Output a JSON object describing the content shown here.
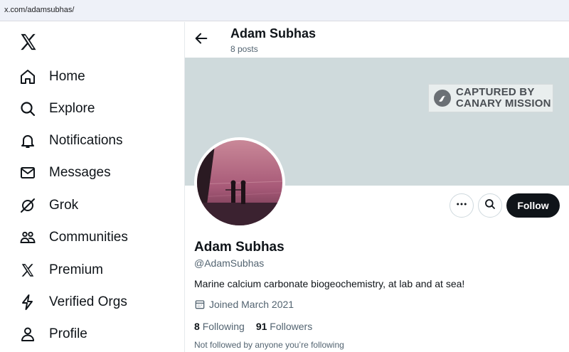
{
  "browser": {
    "url": "x.com/adamsubhas/"
  },
  "sidebar": {
    "logo_icon": "x-logo-icon",
    "items": [
      {
        "label": "Home",
        "icon": "home-icon"
      },
      {
        "label": "Explore",
        "icon": "search-icon"
      },
      {
        "label": "Notifications",
        "icon": "bell-icon"
      },
      {
        "label": "Messages",
        "icon": "envelope-icon"
      },
      {
        "label": "Grok",
        "icon": "grok-icon"
      },
      {
        "label": "Communities",
        "icon": "communities-icon"
      },
      {
        "label": "Premium",
        "icon": "x-premium-icon"
      },
      {
        "label": "Verified Orgs",
        "icon": "lightning-icon"
      },
      {
        "label": "Profile",
        "icon": "person-icon"
      }
    ]
  },
  "header": {
    "name": "Adam Subhas",
    "posts": "8 posts"
  },
  "banner": {
    "watermark_line1": "CAPTURED BY",
    "watermark_line2": "CANARY MISSION",
    "color": "#cfdadc"
  },
  "actions": {
    "follow_label": "Follow"
  },
  "profile": {
    "name": "Adam Subhas",
    "handle": "@AdamSubhas",
    "bio": "Marine calcium carbonate biogeochemistry, at lab and at sea!",
    "joined": "Joined March 2021",
    "following_count": "8",
    "following_label": "Following",
    "followers_count": "91",
    "followers_label": "Followers",
    "followed_note": "Not followed by anyone you’re following"
  }
}
